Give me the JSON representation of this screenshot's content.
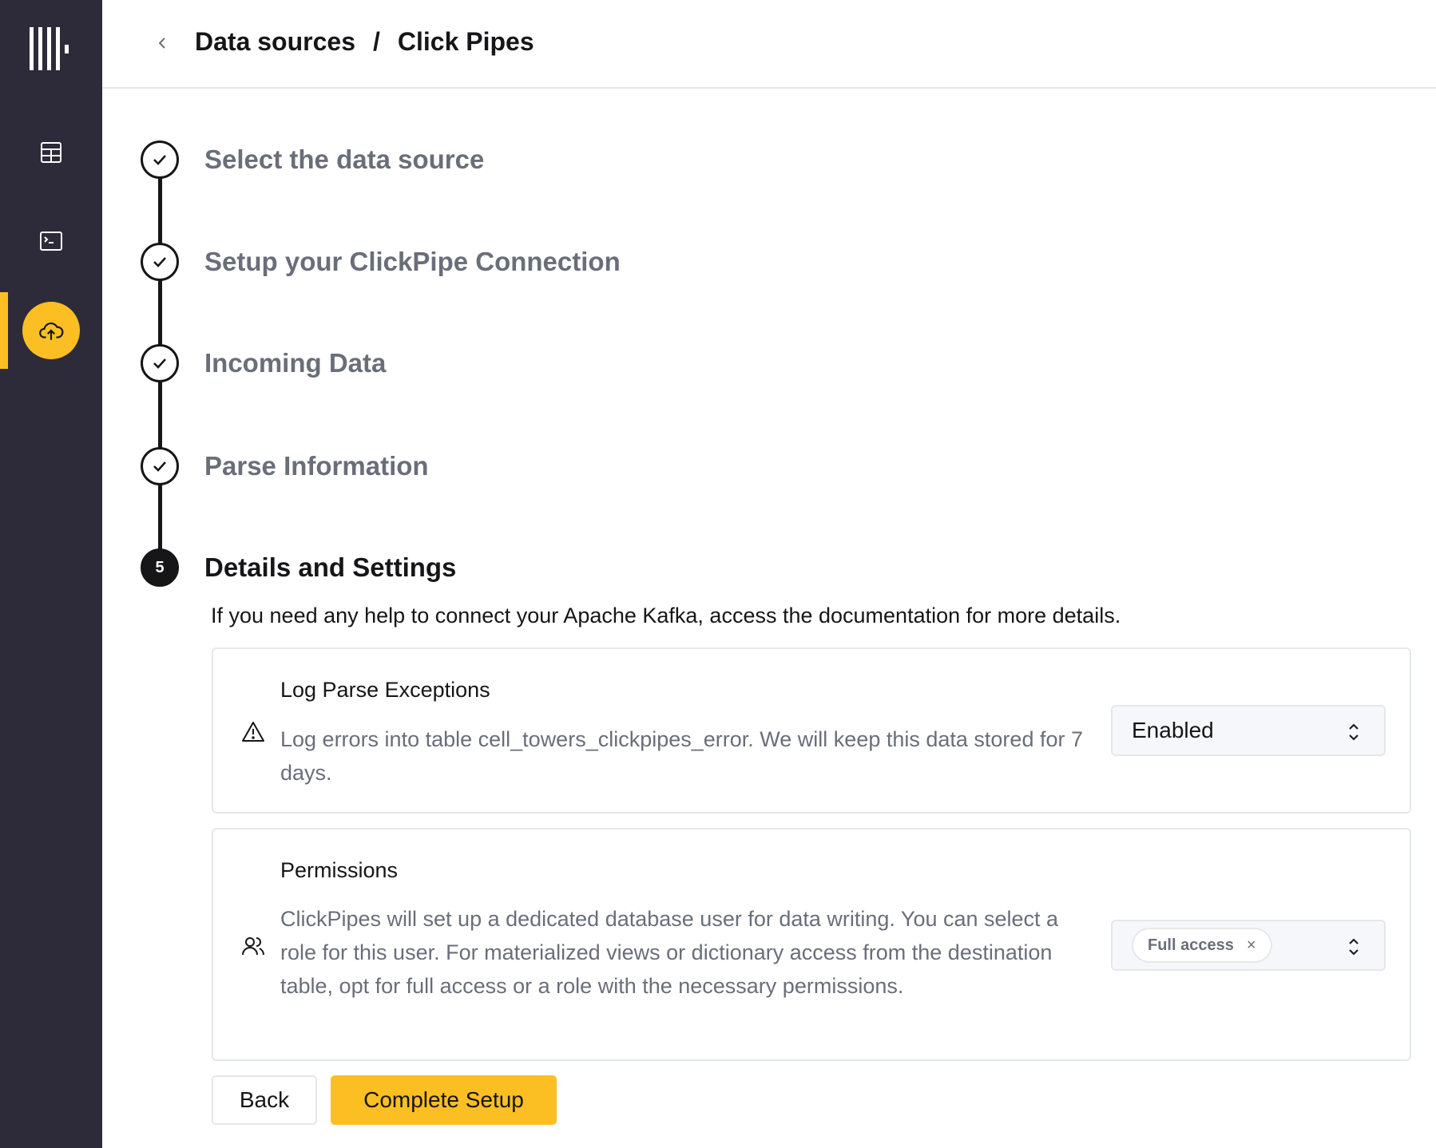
{
  "sidebar": {
    "items": [
      {
        "icon": "table-icon",
        "active": false
      },
      {
        "icon": "terminal-icon",
        "active": false
      },
      {
        "icon": "cloud-upload-icon",
        "active": true
      }
    ],
    "accent_color": "#fbbf24"
  },
  "header": {
    "breadcrumb": [
      "Data sources",
      "/",
      "Click Pipes"
    ]
  },
  "steps": [
    {
      "title": "Select the data source",
      "status": "complete"
    },
    {
      "title": "Setup your ClickPipe Connection",
      "status": "complete"
    },
    {
      "title": "Incoming Data",
      "status": "complete"
    },
    {
      "title": "Parse Information",
      "status": "complete"
    },
    {
      "number": "5",
      "title": "Details and Settings",
      "status": "current"
    }
  ],
  "help_text": "If you need any help to connect your Apache Kafka, access the documentation for more details.",
  "log_parse": {
    "title": "Log Parse Exceptions",
    "description": "Log errors into table cell_towers_clickpipes_error. We will keep this data stored for 7 days.",
    "select_value": "Enabled"
  },
  "permissions": {
    "title": "Permissions",
    "description": "ClickPipes will set up a dedicated database user for data writing. You can select a role for this user. For materialized views or dictionary access from the destination table, opt for full access or a role with the necessary permissions.",
    "chip": "Full access",
    "chip_remove": "×"
  },
  "buttons": {
    "back": "Back",
    "complete": "Complete Setup"
  }
}
